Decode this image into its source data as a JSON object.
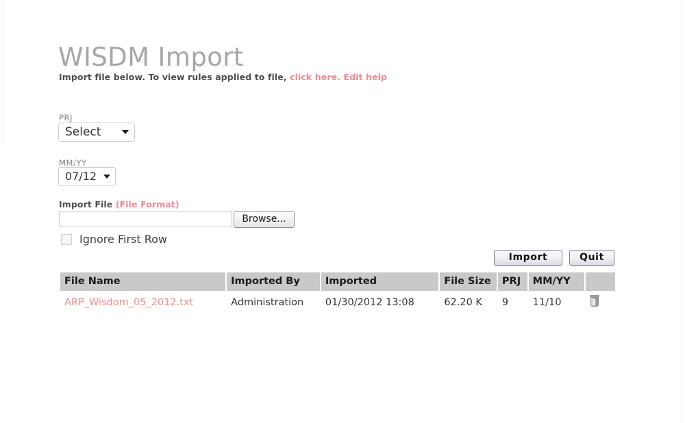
{
  "header": {
    "title": "WISDM Import",
    "subtitle_prefix": "Import file below. To view rules applied to file,",
    "subtitle_link": "click here.",
    "subtitle_link2": "Edit help"
  },
  "form": {
    "prj": {
      "label": "PRJ",
      "value": "Select",
      "arrow_icon": "chevron-down-icon"
    },
    "mmyy": {
      "label": "MM/YY",
      "value": "07/12",
      "arrow_icon": "chevron-down-icon"
    },
    "import_file": {
      "label": "Import File",
      "format_link": "(File Format)",
      "value": "",
      "placeholder": "",
      "browse_label": "Browse..."
    },
    "ignore_first_row": {
      "label": "Ignore First Row",
      "checked": false
    }
  },
  "actions": {
    "import_label": "Import",
    "quit_label": "Quit"
  },
  "table": {
    "columns": [
      "File Name",
      "Imported By",
      "Imported",
      "File Size",
      "PRJ",
      "MM/YY",
      ""
    ],
    "rows": [
      {
        "file_name": "ARP_Wisdom_05_2012.txt",
        "imported_by": "Administration",
        "imported": "01/30/2012 13:08",
        "file_size": "62.20 K",
        "prj": "9",
        "mmyy": "11/10",
        "delete_icon": "trash-icon"
      }
    ]
  },
  "colors": {
    "link_pink": "#ef8b93",
    "title_gray": "#a6a6a6",
    "table_header_gray": "#c9c9c9"
  }
}
